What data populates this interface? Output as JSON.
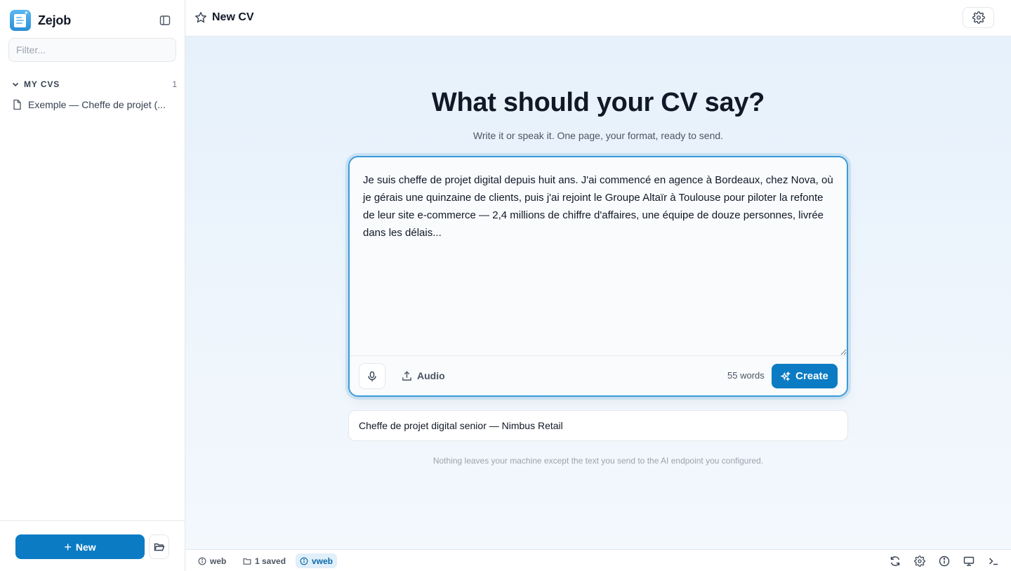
{
  "app": {
    "name": "Zejob"
  },
  "sidebar": {
    "filter_placeholder": "Filter...",
    "section": {
      "title": "MY CVS",
      "count": "1"
    },
    "items": [
      {
        "label": "Exemple — Cheffe de projet (..."
      }
    ],
    "new_label": "New"
  },
  "header": {
    "title": "New CV"
  },
  "main": {
    "title": "What should your CV say?",
    "subtitle": "Write it or speak it. One page, your format, ready to send.",
    "prompt_text": "Je suis cheffe de projet digital depuis huit ans. J'ai commencé en agence à Bordeaux, chez Nova, où je gérais une quinzaine de clients, puis j'ai rejoint le Groupe Altaïr à Toulouse pour piloter la refonte de leur site e-commerce — 2,4 millions de chiffre d'affaires, une équipe de douze personnes, livrée dans les délais...",
    "audio_label": "Audio",
    "word_count": "55 words",
    "create_label": "Create",
    "target_value": "Cheffe de projet digital senior — Nimbus Retail",
    "privacy_note": "Nothing leaves your machine except the text you send to the AI endpoint you configured."
  },
  "status": {
    "chips": [
      {
        "label": "web",
        "icon": "info-icon"
      },
      {
        "label": "1 saved",
        "icon": "folder-icon"
      },
      {
        "label": "vweb",
        "icon": "info-icon"
      }
    ],
    "right_icons": [
      "refresh-icon",
      "gear-icon",
      "info-icon",
      "monitor-icon",
      "terminal-icon"
    ]
  },
  "colors": {
    "accent": "#0b7bc4",
    "focus_ring": "#3b9ad8",
    "background_tint": "#e6f1fb"
  }
}
